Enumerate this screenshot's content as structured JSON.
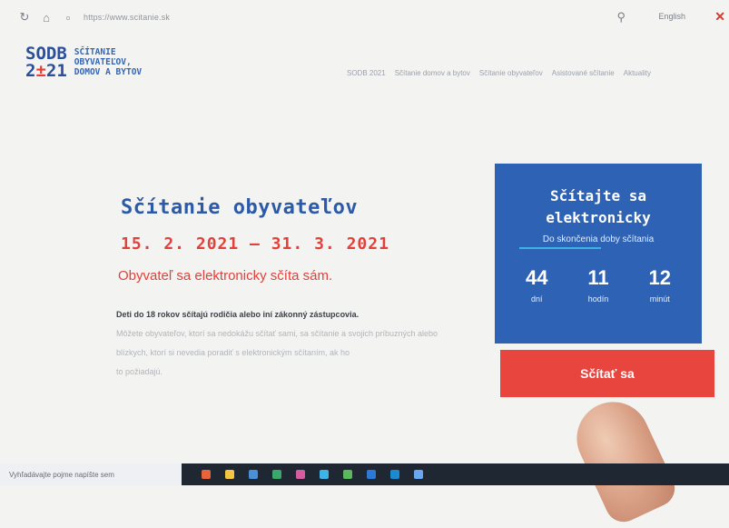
{
  "browser": {
    "url": "https://www.scitanie.sk",
    "language": "English"
  },
  "header": {
    "logo_mark_line1": "SODB",
    "logo_mark_line2_a": "2",
    "logo_mark_line2_b": "±",
    "logo_mark_line2_c": "21",
    "logo_text": [
      "SČÍTANIE",
      "OBYVATEĽOV,",
      "DOMOV A BYTOV"
    ],
    "nav": [
      "SODB 2021",
      "Sčítanie domov a bytov",
      "Sčítanie obyvateľov",
      "Asistované sčítanie",
      "Aktuality"
    ]
  },
  "hero": {
    "title": "Sčítanie obyvateľov",
    "dates": "15. 2. 2021 – 31. 3. 2021",
    "tagline": "Obyvateľ sa elektronicky sčíta sám.",
    "lead": "Deti do 18 rokov sčítajú rodičia alebo iní zákonný zástupcovia.",
    "body_lines": [
      "Môžete obyvateľov, ktorí sa nedokážu sčítať sami, sa sčítanie a svojich príbuzných alebo",
      "blízkych, ktorí si nevedia poradiť s elektronickým sčítaním, ak ho",
      "to požiadajú."
    ]
  },
  "countdown": {
    "title_line1": "Sčítajte sa",
    "title_line2": "elektronicky",
    "subtitle": "Do skončenia doby sčítania",
    "units": [
      {
        "value": "44",
        "label": "dní"
      },
      {
        "value": "11",
        "label": "hodín"
      },
      {
        "value": "12",
        "label": "minút"
      }
    ],
    "cta_label": "Sčítať sa"
  },
  "taskbar": {
    "search_placeholder": "Vyhľadávajte pojme napíšte sem",
    "app_colors": [
      "#e8633a",
      "#f4c542",
      "#4a90d9",
      "#3aa86b",
      "#d65ca0",
      "#3fb2e8",
      "#5cb85c",
      "#2b7bd6",
      "#1a8ad1",
      "#6aa7f0"
    ]
  },
  "colors": {
    "brand_blue": "#2d62b4",
    "brand_red": "#e2403a"
  }
}
